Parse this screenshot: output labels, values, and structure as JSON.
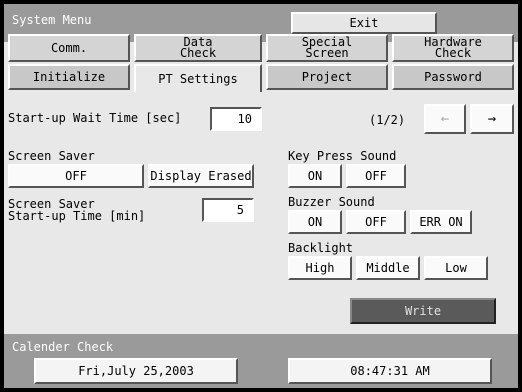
{
  "header": {
    "title": "System Menu",
    "exit_label": "Exit"
  },
  "tabs_back": [
    {
      "label": "Comm."
    },
    {
      "label": "Data\nCheck"
    },
    {
      "label": "Special\nScreen"
    },
    {
      "label": "Hardware\nCheck"
    }
  ],
  "tabs_front": [
    {
      "label": "Initialize"
    },
    {
      "label": "PT Settings",
      "active": true
    },
    {
      "label": "Project"
    },
    {
      "label": "Password"
    }
  ],
  "startup": {
    "label": "Start-up Wait Time [sec]",
    "value": "10"
  },
  "pager": {
    "label": "(1/2)",
    "prev_icon": "left-arrow-icon",
    "next_icon": "right-arrow-icon",
    "prev_glyph": "←",
    "next_glyph": "→"
  },
  "screen_saver": {
    "label": "Screen Saver",
    "options": [
      "OFF",
      "Display Erased"
    ],
    "startup_label_line1": "Screen Saver",
    "startup_label_line2": "Start-up Time [min]",
    "startup_value": "5"
  },
  "key_press_sound": {
    "label": "Key Press Sound",
    "options": [
      "ON",
      "OFF"
    ]
  },
  "buzzer_sound": {
    "label": "Buzzer Sound",
    "options": [
      "ON",
      "OFF",
      "ERR ON"
    ]
  },
  "backlight": {
    "label": "Backlight",
    "options": [
      "High",
      "Middle",
      "Low"
    ]
  },
  "write_label": "Write",
  "calendar": {
    "label": "Calender Check",
    "date": "Fri,July 25,2003",
    "time": "08:47:31 AM"
  },
  "colors": {
    "panel": "#e8e8e8",
    "title_bar": "#9a9a9a",
    "write_button": "#5a5a5a"
  }
}
